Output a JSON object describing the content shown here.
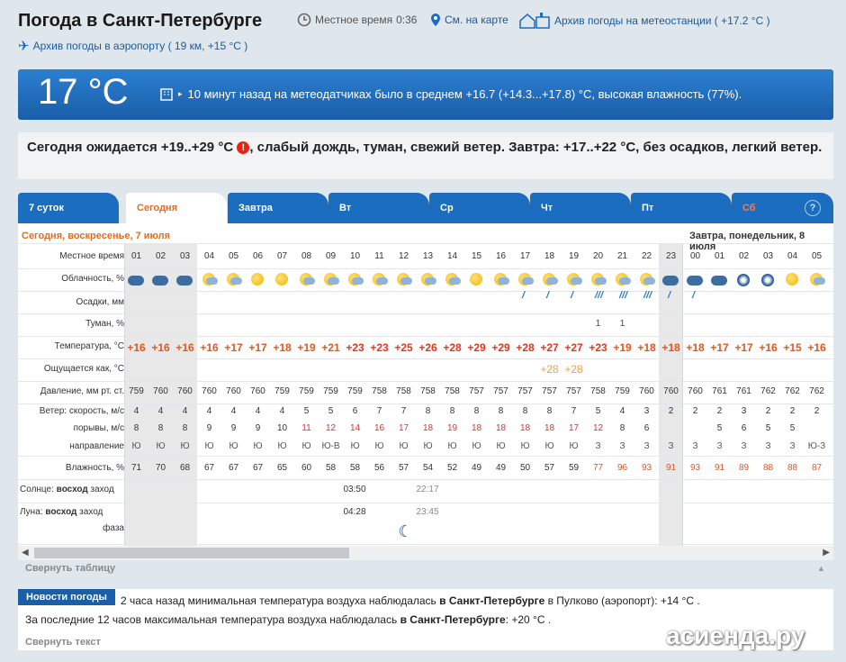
{
  "header": {
    "title": "Погода в Санкт-Петербурге",
    "local_time_label": "Местное время",
    "local_time": "0:36",
    "map_link": "См. на карте",
    "station_archive": "Архив погоды на метеостанции ( +17.2 °C )",
    "airport_archive": "Архив погоды в аэропорту ( 19 км, +15 °C )"
  },
  "now": {
    "temp": "17 °C",
    "message": "10 минут назад на метеодатчиках было в среднем +16.7 (+14.3...+17.8) °C, высокая влажность (77%)."
  },
  "forecast_text": {
    "part1": "Сегодня ожидается +19..+29 °C",
    "alert_icon": "!",
    "part2": ", слабый дождь, туман, свежий ветер. Завтра: +17..+22 °C, без осадков, легкий ветер."
  },
  "tabs": [
    "7 суток",
    "Сегодня",
    "Завтра",
    "Вт",
    "Ср",
    "Чт",
    "Пт",
    "Сб"
  ],
  "help_label": "?",
  "table": {
    "today_label": "Сегодня, воскресенье, 7 июля",
    "tomorrow_label": "Завтра, понедельник, 8 июля",
    "row_labels": {
      "time": "Местное время",
      "clouds": "Облачность, %",
      "precip": "Осадки, мм",
      "fog": "Туман, %",
      "temp": "Температура, °C",
      "feels": "Ощущается как, °C",
      "pressure": "Давление, мм рт. ст.",
      "wind_speed": "Ветер: скорость, м/с",
      "gusts": "порывы, м/с",
      "direction": "направление",
      "humidity": "Влажность, %",
      "sun_prefix": "Солнце:",
      "sun_rise": "восход",
      "sun_set": "заход",
      "moon_prefix": "Луна:",
      "moon_rise": "восход",
      "moon_set": "заход",
      "phase": "фаза"
    },
    "hours": [
      "01",
      "02",
      "03",
      "04",
      "05",
      "06",
      "07",
      "08",
      "09",
      "10",
      "11",
      "12",
      "13",
      "14",
      "15",
      "16",
      "17",
      "18",
      "19",
      "20",
      "21",
      "22",
      "23",
      "00",
      "01",
      "02",
      "03",
      "04",
      "05"
    ],
    "temp": [
      "+16",
      "+16",
      "+16",
      "+16",
      "+17",
      "+17",
      "+18",
      "+19",
      "+21",
      "+23",
      "+23",
      "+25",
      "+26",
      "+28",
      "+29",
      "+29",
      "+28",
      "+27",
      "+27",
      "+23",
      "+19",
      "+18",
      "+18",
      "+18",
      "+17",
      "+17",
      "+16",
      "+15",
      "+16"
    ],
    "feels": [
      "",
      "",
      "",
      "",
      "",
      "",
      "",
      "",
      "",
      "",
      "",
      "",
      "",
      "",
      "",
      "",
      "",
      "+28",
      "+28",
      "",
      "",
      "",
      "",
      "",
      "",
      "",
      "",
      "",
      ""
    ],
    "pressure": [
      "759",
      "760",
      "760",
      "760",
      "760",
      "760",
      "759",
      "759",
      "759",
      "759",
      "758",
      "758",
      "758",
      "758",
      "757",
      "757",
      "757",
      "757",
      "757",
      "758",
      "759",
      "760",
      "760",
      "760",
      "761",
      "761",
      "762",
      "762",
      "762"
    ],
    "wind_speed": [
      "4",
      "4",
      "4",
      "4",
      "4",
      "4",
      "4",
      "5",
      "5",
      "6",
      "7",
      "7",
      "8",
      "8",
      "8",
      "8",
      "8",
      "8",
      "7",
      "5",
      "4",
      "3",
      "2",
      "2",
      "2",
      "3",
      "2",
      "2",
      "2"
    ],
    "gusts": [
      "8",
      "8",
      "8",
      "9",
      "9",
      "9",
      "10",
      "11",
      "12",
      "14",
      "16",
      "17",
      "18",
      "19",
      "18",
      "18",
      "18",
      "18",
      "17",
      "12",
      "8",
      "6",
      "",
      "",
      "5",
      "6",
      "5",
      "5",
      ""
    ],
    "direction": [
      "Ю",
      "Ю",
      "Ю",
      "Ю",
      "Ю",
      "Ю",
      "Ю",
      "Ю",
      "Ю-В",
      "Ю",
      "Ю",
      "Ю",
      "Ю",
      "Ю",
      "Ю",
      "Ю",
      "Ю",
      "Ю",
      "Ю",
      "З",
      "З",
      "З",
      "З",
      "З",
      "З",
      "З",
      "З",
      "З",
      "Ю-З"
    ],
    "humidity": [
      "71",
      "70",
      "68",
      "67",
      "67",
      "67",
      "65",
      "60",
      "58",
      "58",
      "56",
      "57",
      "54",
      "52",
      "49",
      "49",
      "50",
      "57",
      "59",
      "77",
      "96",
      "93",
      "91",
      "93",
      "91",
      "89",
      "88",
      "88",
      "87"
    ],
    "fog": [
      "",
      "",
      "",
      "",
      "",
      "",
      "",
      "",
      "",
      "",
      "",
      "",
      "",
      "",
      "",
      "",
      "",
      "",
      "",
      "1",
      "1",
      "",
      "",
      "",
      "",
      "",
      "",
      "",
      ""
    ],
    "sunrise": "03:50",
    "sunset": "22:17",
    "moonrise": "04:28",
    "moonset": "23:45",
    "colors": {
      "warm": "#e8541a",
      "hot": "#e8341a",
      "muted": "#f0a040",
      "gust": "#d9342a"
    }
  },
  "collapse_table": "Свернуть таблицу",
  "news": {
    "tag": "Новости погоды",
    "line1_a": "2 часа назад минимальная температура воздуха наблюдалась ",
    "line1_b": "в Санкт-Петербурге",
    "line1_c": " в Пулково (аэропорт): +14 °C .",
    "line2_a": "За последние 12 часов максимальная температура воздуха наблюдалась ",
    "line2_b": "в Санкт-Петербурге",
    "line2_c": ": +20 °C .",
    "collapse": "Свернуть текст"
  },
  "watermark": "асиенда.ру"
}
